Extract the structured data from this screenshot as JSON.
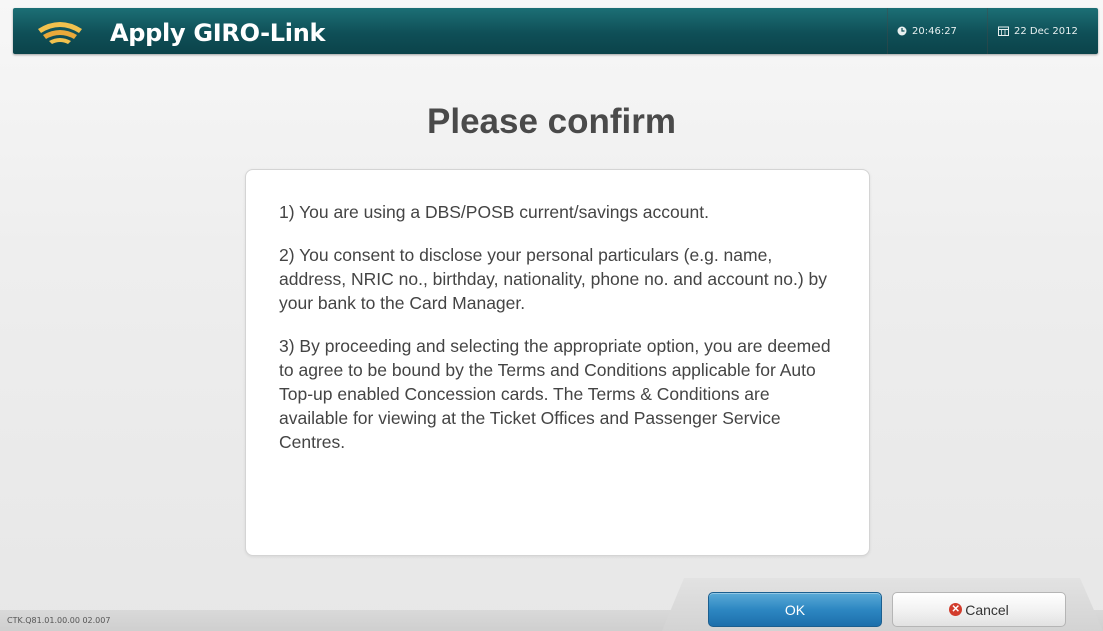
{
  "header": {
    "title": "Apply GIRO-Link",
    "time": "20:46:27",
    "date": "22 Dec 2012"
  },
  "page": {
    "title": "Please confirm"
  },
  "terms": [
    "1) You are using a DBS/POSB current/savings account.",
    "2) You consent to disclose your personal particulars (e.g. name, address, NRIC no., birthday, nationality, phone no. and account no.) by your bank to the Card Manager.",
    "3) By proceeding and selecting the appropriate option, you are deemed to agree to be bound by the Terms and Conditions applicable for Auto Top-up enabled Concession cards. The Terms & Conditions are available for viewing at the Ticket Offices and Passenger Service Centres."
  ],
  "buttons": {
    "ok_label": "OK",
    "cancel_label": "Cancel"
  },
  "footer": {
    "version": "CTK.Q81.01.00.00 02.007"
  },
  "icons": {
    "logo": "transit-logo-icon",
    "time": "clock-icon",
    "date": "calendar-icon",
    "cancel": "cancel-x-icon"
  },
  "colors": {
    "header": "#0f4f57",
    "ok_button": "#2d87c2",
    "cancel_icon": "#d23c2c",
    "logo": "#f2c14e"
  }
}
